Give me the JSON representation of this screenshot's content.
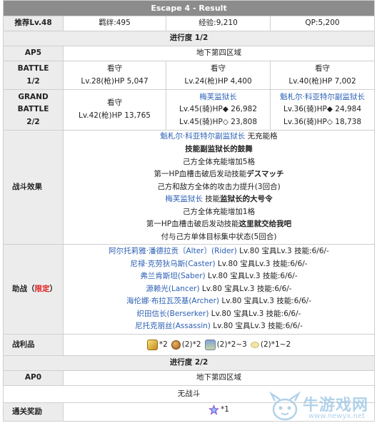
{
  "title": "Escape 4 - Result",
  "info": {
    "recommended_level": "推荐Lv.48",
    "bond": "羁绊:495",
    "exp": "经验:9,210",
    "qp": "QP:5,200"
  },
  "progress1": {
    "header": "进行度 1/2",
    "ap_label": "AP5",
    "location": "地下第四区域",
    "battle1": {
      "label_line1": "BATTLE",
      "label_line2": "1/2",
      "enemies": [
        {
          "name": "看守",
          "stats": "Lv.28(枪)HP 5,047"
        },
        {
          "name": "看守",
          "stats": "Lv.24(枪)HP 4,400"
        },
        {
          "name": "看守",
          "stats": "Lv.40(枪)HP 7,002"
        }
      ]
    },
    "battle2": {
      "label_line1": "GRAND",
      "label_line2": "BATTLE",
      "label_line3": "2/2",
      "enemy1": {
        "name": "看守",
        "stats": "Lv.42(枪)HP 13,765"
      },
      "enemy2": {
        "name": "梅芙监狱长",
        "stats1": "Lv.45(骑)HP◆ 26,982",
        "stats2": "Lv.45(骑)HP◇ 23,808"
      },
      "enemy3": {
        "name": "魁札尔·科亚特尔副监狱长",
        "stats1": "Lv.36(骑)HP◆ 24,984",
        "stats2": "Lv.36(骑)HP◇ 18,738"
      }
    },
    "effects": {
      "label": "战斗效果",
      "l1_name": "魁札尔·科亚特尔副监狱长",
      "l1_rest": " 无充能格",
      "l2": "技能副监狱长的鼓舞",
      "l3": "己方全体充能增加5格",
      "l4_pre": "第一HP血槽击破后发动技能",
      "l4_skill": "デスマッチ",
      "l5": "己方和敌方全体的攻击力提升(3回合)",
      "l6_name": "梅芙监狱长",
      "l6_pre": " 技能",
      "l6_skill": "监狱长的大号令",
      "l7": "己方全体充能增加1格",
      "l8_pre": "第一HP血槽击破后发动技能",
      "l8_skill": "这里就交给我吧",
      "l9": "付与己方单体目标集中状态(5回合)"
    },
    "support": {
      "label_pre": "助战（",
      "label_red": "限定",
      "label_post": "）",
      "rows": [
        {
          "name": "阿尔托莉雅·潘德拉贡〔Alter〕(Rider)",
          "info": " Lv.80 宝具Lv.3 技能:6/6/-"
        },
        {
          "name": "尼禄·克劳狄乌斯(Caster)",
          "info": " Lv.80 宝具Lv.3 技能:6/6/-"
        },
        {
          "name": "弗兰肯斯坦(Saber)",
          "info": " Lv.80 宝具Lv.3 技能:6/6/-"
        },
        {
          "name": "源赖光(Lancer)",
          "info": " Lv.80 宝具Lv.3 技能:6/6/-"
        },
        {
          "name": "海伦娜·布拉瓦茨基(Archer)",
          "info": " Lv.80 宝具Lv.3 技能:6/6/-"
        },
        {
          "name": "织田信长(Berserker)",
          "info": " Lv.80 宝具Lv.3 技能:6/6/-"
        },
        {
          "name": "尼托克丽丝(Assassin)",
          "info": " Lv.80 宝具Lv.3 技能:6/6/-"
        }
      ]
    },
    "drops": {
      "label": "战利品",
      "items": [
        {
          "icon": "gold-statue-icon",
          "text": "*2"
        },
        {
          "icon": "bronze-coin-icon",
          "text": "(2)*2"
        },
        {
          "icon": "scroll-item-icon",
          "text": "(2)*2~3"
        },
        {
          "icon": "bean-item-icon",
          "text": "(2)*1~2"
        }
      ]
    }
  },
  "progress2": {
    "header": "进行度 2/2",
    "ap_label": "AP0",
    "location": "地下第四区域",
    "no_battle": "无战斗",
    "reward_label": "通关奖励",
    "reward_text": "*1",
    "reward_icon": "saint-quartz-icon"
  },
  "watermark": {
    "text": "牛游戏网",
    "url": "www.newyx.net"
  },
  "colors": {
    "title_bar": "#8c8c8c",
    "header_bg": "#ececec",
    "link": "#2b5fb4",
    "limited": "#e02020"
  }
}
